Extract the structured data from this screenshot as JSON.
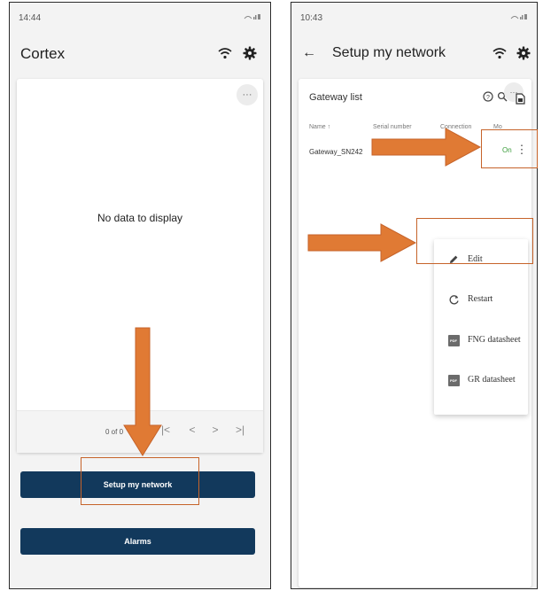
{
  "colors": {
    "primary_button": "#12395c",
    "annotation_orange": "#e07a34",
    "annotation_outline": "#c6632a",
    "status_on": "#3a9c3a"
  },
  "left_screen": {
    "status_time": "14:44",
    "status_icons": "wifi-icon signal-icon battery-icon",
    "app_title": "Cortex",
    "toolbar_icons": [
      "wifi-icon",
      "gear-icon"
    ],
    "card_menu_icon": "more-horizontal-icon",
    "card_menu_label": "···",
    "empty_message": "No data to display",
    "pager": {
      "page_text": "0 of 0",
      "buttons": [
        {
          "icon": "first-page-icon",
          "label": "|<"
        },
        {
          "icon": "previous-page-icon",
          "label": "<"
        },
        {
          "icon": "next-page-icon",
          "label": ">"
        },
        {
          "icon": "last-page-icon",
          "label": ">|"
        }
      ]
    },
    "setup_button_label": "Setup my network",
    "alarms_button_label": "Alarms"
  },
  "right_screen": {
    "status_time": "10:43",
    "status_icons": "wifi-icon signal-icon battery-icon",
    "back_icon": "back-arrow-icon",
    "back_label": "←",
    "app_title": "Setup my network",
    "toolbar_icons": [
      "wifi-icon",
      "gear-icon"
    ],
    "grid": {
      "title": "Gateway list",
      "toolbar": [
        "help-icon",
        "search-icon",
        "export-icon"
      ],
      "columns": [
        "Name ↑",
        "Serial number",
        "Connection",
        "Mo"
      ],
      "rows": [
        {
          "name": "Gateway_SN242",
          "status": "On"
        }
      ]
    },
    "context_menu": {
      "items": [
        {
          "label": "Edit",
          "icon": "pencil-icon"
        },
        {
          "label": "Restart",
          "icon": "restart-icon"
        },
        {
          "label": "FNG datasheet",
          "icon": "pdf-icon"
        },
        {
          "label": "GR datasheet",
          "icon": "pdf-icon"
        }
      ],
      "pdf_badge": "PDF"
    }
  }
}
